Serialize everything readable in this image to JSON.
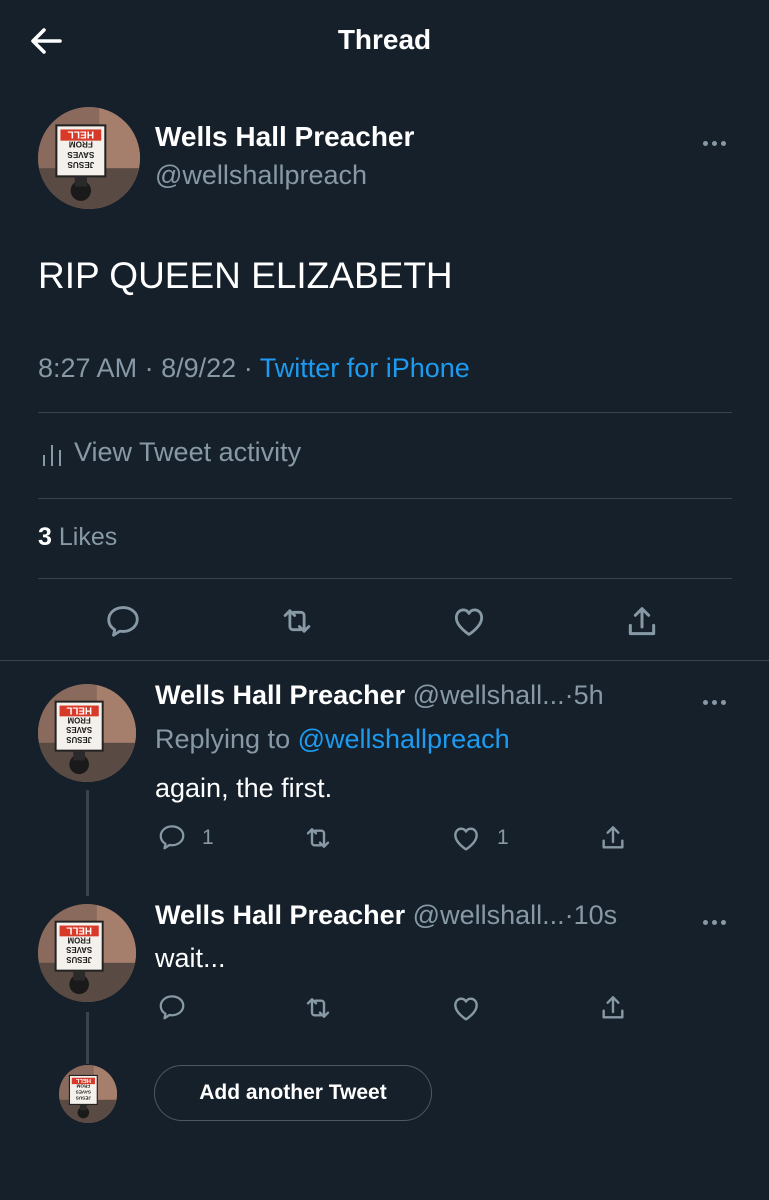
{
  "header": {
    "title": "Thread"
  },
  "main_tweet": {
    "author_name": "Wells Hall Preacher",
    "handle": "@wellshallpreach",
    "text": "RIP QUEEN ELIZABETH",
    "time": "8:27 AM",
    "separator1": "·",
    "date": "8/9/22",
    "separator2": "·",
    "source": "Twitter for iPhone",
    "activity_label": "View Tweet activity",
    "likes_count": "3",
    "likes_label": "Likes"
  },
  "reply1": {
    "author_name": "Wells Hall Preacher",
    "handle": "@wellshall...",
    "separator": "·",
    "time": "5h",
    "replying_label": "Replying to",
    "replying_handle": "@wellshallpreach",
    "text": "again, the first.",
    "reply_count": "1",
    "like_count": "1"
  },
  "reply2": {
    "author_name": "Wells Hall Preacher",
    "handle": "@wellshall...",
    "separator": "·",
    "time": "10s",
    "text": "wait..."
  },
  "compose": {
    "add_button_label": "Add another Tweet"
  },
  "avatar_sign": {
    "line1": "HELL",
    "line2": "FROM",
    "line3": "SAVES",
    "line4": "JESUS"
  },
  "colors": {
    "background": "#15202b",
    "link": "#1d9bf0",
    "muted": "#8899a6",
    "divider": "#38444d"
  },
  "icons": [
    "back-arrow-icon",
    "more-icon",
    "reply-icon",
    "retweet-icon",
    "like-icon",
    "share-icon",
    "activity-bar-icon"
  ]
}
